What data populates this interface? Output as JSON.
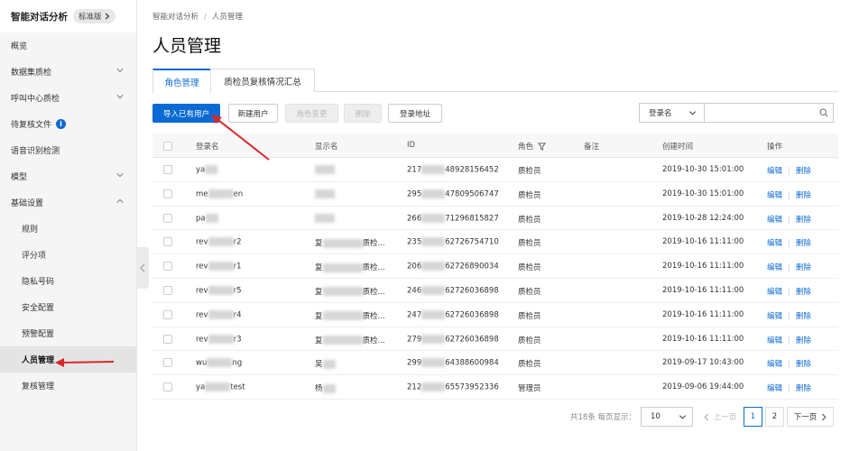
{
  "sidebar": {
    "title": "智能对话分析",
    "badge": "标准版",
    "items": [
      {
        "label": "概览",
        "chevron": "",
        "info": false,
        "sub": false,
        "active": false
      },
      {
        "label": "数据集质检",
        "chevron": "down",
        "info": false,
        "sub": false,
        "active": false
      },
      {
        "label": "呼叫中心质检",
        "chevron": "down",
        "info": false,
        "sub": false,
        "active": false
      },
      {
        "label": "待复核文件",
        "chevron": "",
        "info": true,
        "sub": false,
        "active": false
      },
      {
        "label": "语音识别检测",
        "chevron": "",
        "info": false,
        "sub": false,
        "active": false
      },
      {
        "label": "模型",
        "chevron": "down",
        "info": false,
        "sub": false,
        "active": false
      },
      {
        "label": "基础设置",
        "chevron": "up",
        "info": false,
        "sub": false,
        "active": false
      },
      {
        "label": "规则",
        "chevron": "",
        "info": false,
        "sub": true,
        "active": false
      },
      {
        "label": "评分项",
        "chevron": "",
        "info": false,
        "sub": true,
        "active": false
      },
      {
        "label": "隐私号码",
        "chevron": "",
        "info": false,
        "sub": true,
        "active": false
      },
      {
        "label": "安全配置",
        "chevron": "",
        "info": false,
        "sub": true,
        "active": false
      },
      {
        "label": "预警配置",
        "chevron": "",
        "info": false,
        "sub": true,
        "active": false
      },
      {
        "label": "人员管理",
        "chevron": "",
        "info": false,
        "sub": true,
        "active": true
      },
      {
        "label": "复核管理",
        "chevron": "",
        "info": false,
        "sub": true,
        "active": false
      }
    ]
  },
  "breadcrumb": {
    "root": "智能对话分析",
    "separator": "/",
    "current": "人员管理"
  },
  "page_title": "人员管理",
  "tabs": [
    {
      "label": "角色管理",
      "active": true
    },
    {
      "label": "质检员复核情况汇总",
      "active": false
    }
  ],
  "toolbar": {
    "import_label": "导入已有用户",
    "new_label": "新建用户",
    "role_change_label": "角色变更",
    "delete_label": "删除",
    "login_addr_label": "登录地址"
  },
  "search": {
    "field": "登录名",
    "placeholder": ""
  },
  "table": {
    "headers": {
      "login": "登录名",
      "display": "显示名",
      "id": "ID",
      "role": "角色",
      "note": "备注",
      "created": "创建时间",
      "ops": "操作"
    },
    "rows": [
      {
        "login": "ya",
        "login_tail": "",
        "display": "",
        "display_tail": "",
        "id_head": "217",
        "id_tail": "48928156452",
        "role": "质检员",
        "created": "2019-10-30 15:01:00"
      },
      {
        "login": "me",
        "login_tail": "en",
        "display": "",
        "display_tail": "",
        "id_head": "295",
        "id_tail": "47809506747",
        "role": "质检员",
        "created": "2019-10-30 15:01:00"
      },
      {
        "login": "pa",
        "login_tail": "",
        "display": "",
        "display_tail": "",
        "id_head": "266",
        "id_tail": "71296815827",
        "role": "质检员",
        "created": "2019-10-28 12:24:00"
      },
      {
        "login": "rev",
        "login_tail": "r2",
        "display": "复",
        "display_tail": "质检...",
        "id_head": "235",
        "id_tail": "62726754710",
        "role": "质检员",
        "created": "2019-10-16 11:11:00"
      },
      {
        "login": "rev",
        "login_tail": "r1",
        "display": "复",
        "display_tail": "质检...",
        "id_head": "206",
        "id_tail": "62726890034",
        "role": "质检员",
        "created": "2019-10-16 11:11:00"
      },
      {
        "login": "rev",
        "login_tail": "r5",
        "display": "复",
        "display_tail": "质检...",
        "id_head": "246",
        "id_tail": "62726036898",
        "role": "质检员",
        "created": "2019-10-16 11:11:00"
      },
      {
        "login": "rev",
        "login_tail": "r4",
        "display": "复",
        "display_tail": "质检...",
        "id_head": "247",
        "id_tail": "62726036898",
        "role": "质检员",
        "created": "2019-10-16 11:11:00"
      },
      {
        "login": "rev",
        "login_tail": "r3",
        "display": "复",
        "display_tail": "质检...",
        "id_head": "279",
        "id_tail": "62726036898",
        "role": "质检员",
        "created": "2019-10-16 11:11:00"
      },
      {
        "login": "wu",
        "login_tail": "ng",
        "display": "吴",
        "display_tail": "",
        "id_head": "299",
        "id_tail": "64388600984",
        "role": "质检员",
        "created": "2019-09-17 10:43:00"
      },
      {
        "login": "ya",
        "login_tail": "test",
        "display": "杨",
        "display_tail": "",
        "id_head": "212",
        "id_tail": "65573952336",
        "role": "管理员",
        "created": "2019-09-06 19:44:00"
      }
    ],
    "edit_label": "编辑",
    "delete_label": "删除"
  },
  "pagination": {
    "total": "共18条",
    "per_page_label": "每页显示：",
    "page_size": "10",
    "prev": "上一页",
    "pages": [
      "1",
      "2"
    ],
    "current": "1",
    "next": "下一页"
  },
  "colors": {
    "accent": "#0a6ad4",
    "annotation": "#d9262b"
  }
}
